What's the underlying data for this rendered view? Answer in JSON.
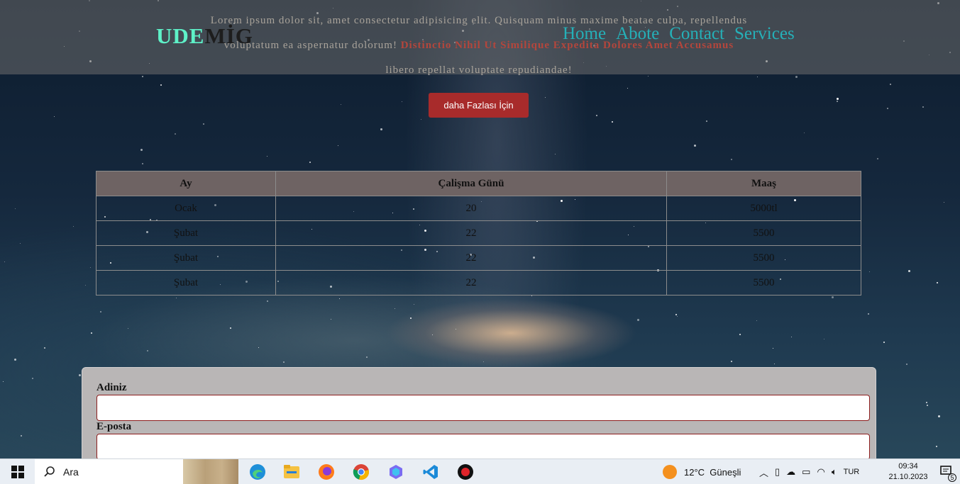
{
  "header": {
    "hero_line1": "Lorem ipsum dolor sit, amet consectetur adipisicing elit. Quisquam minus maxime beatae culpa, repellendus",
    "hero_line2_start": "voluptatum ea aspernatur dolorum!",
    "hero_line2_red": "Distinctio Nihil Ut Similique Expedita Dolores Amet Accusamus",
    "hero_line3": "libero repellat voluptate repudiandae!",
    "logo_part1": "UDE",
    "logo_part2": "MİG",
    "nav": [
      "Home",
      "Abote",
      "Contact",
      "Services"
    ]
  },
  "more_button": "daha Fazlası İçin",
  "table": {
    "headers": [
      "Ay",
      "Çalişma Günü",
      "Maaş"
    ],
    "rows": [
      [
        "Ocak",
        "20",
        "5000tl"
      ],
      [
        "Şubat",
        "22",
        "5500"
      ],
      [
        "Şubat",
        "22",
        "5500"
      ],
      [
        "Şubat",
        "22",
        "5500"
      ]
    ]
  },
  "form": {
    "name_label": "Adiniz",
    "email_label": "E-posta",
    "name_value": "",
    "email_value": ""
  },
  "taskbar": {
    "search_placeholder": "Ara",
    "weather": "12°C  Güneşli",
    "language": "TUR",
    "time": "09:34",
    "date": "21.10.2023",
    "notification_count": "5",
    "icons": [
      "windows-start-icon",
      "search-icon",
      "edge-icon",
      "file-explorer-icon",
      "firefox-icon",
      "chrome-icon",
      "copilot-icon",
      "vscode-icon",
      "record-icon"
    ]
  }
}
